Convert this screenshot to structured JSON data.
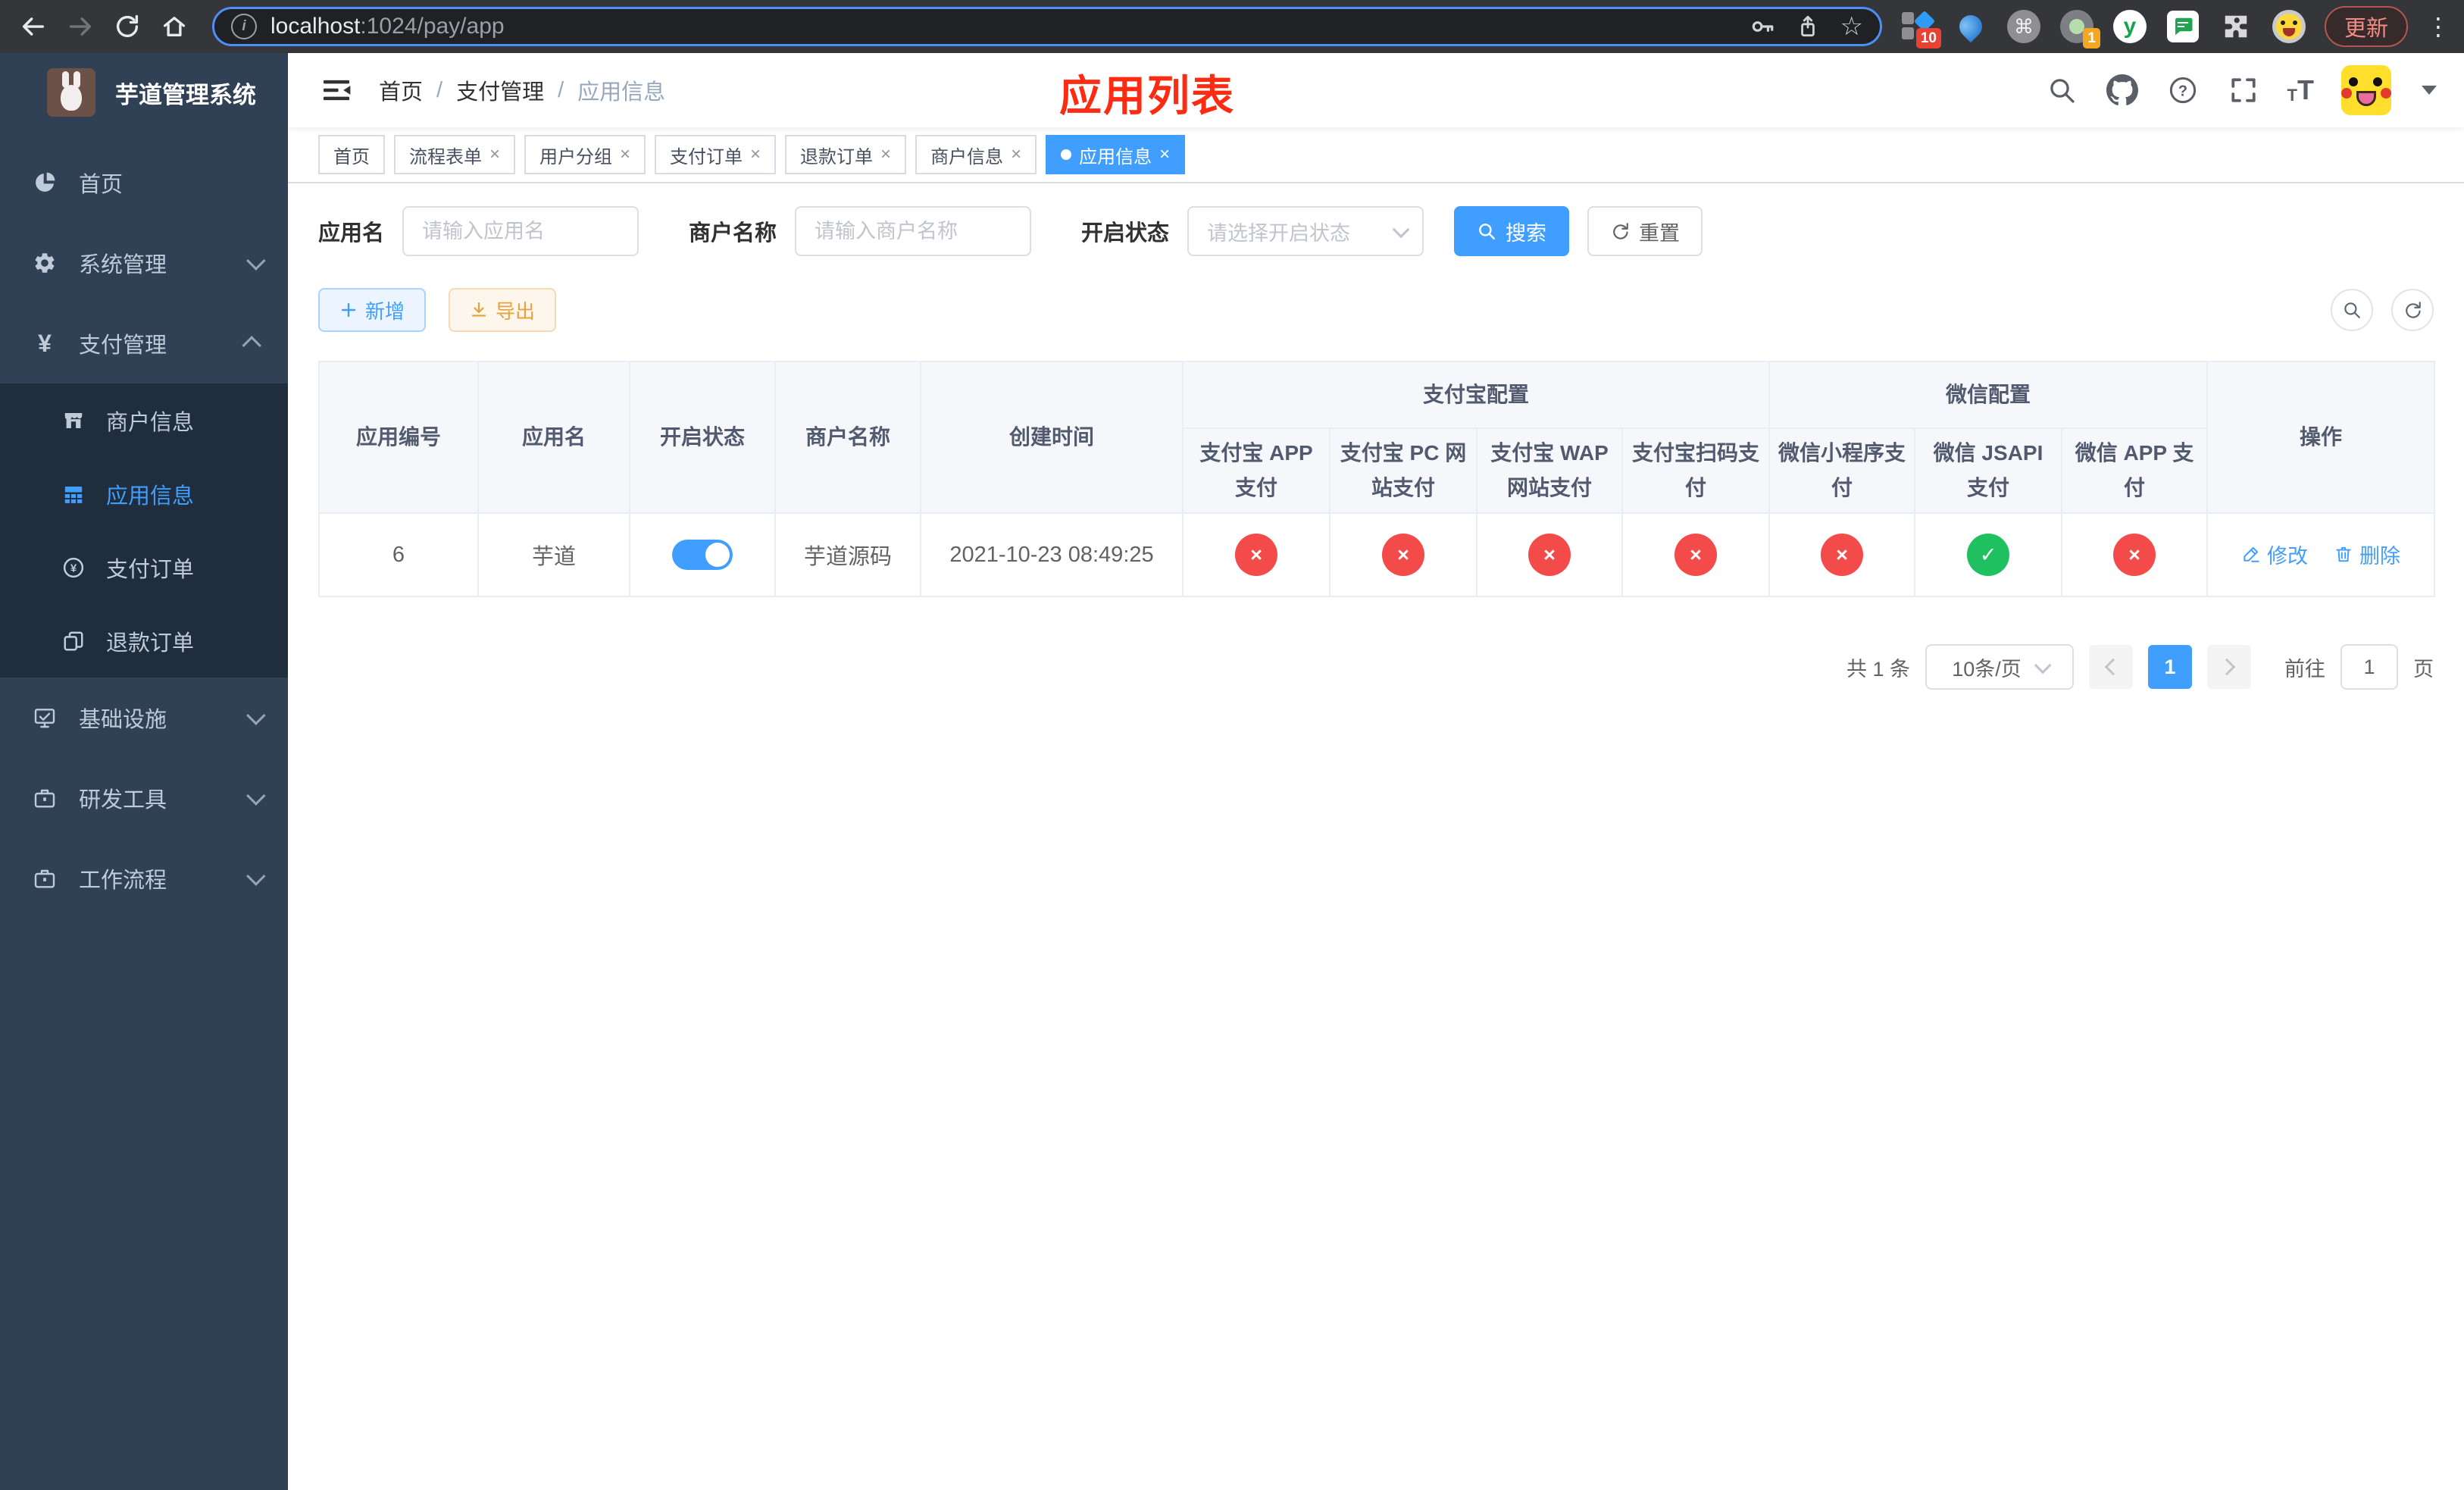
{
  "browser": {
    "url_host": "localhost",
    "url_path": ":1024/pay/app",
    "update_label": "更新"
  },
  "glyphs": {
    "close": "×",
    "cross": "×",
    "check": "✓",
    "cmd": "⌘",
    "more_dots": "⋮",
    "star": "☆",
    "info_i": "i",
    "question": "?",
    "badge_ten": "10",
    "badge_one": "1",
    "ext_y": "y",
    "yen": "¥",
    "font_small": "T",
    "font_large": "T"
  },
  "sidebar": {
    "title": "芋道管理系统",
    "menu": [
      {
        "label": "首页"
      },
      {
        "label": "系统管理"
      },
      {
        "label": "支付管理"
      },
      {
        "label": "基础设施"
      },
      {
        "label": "研发工具"
      },
      {
        "label": "工作流程"
      }
    ],
    "submenu": [
      {
        "label": "商户信息"
      },
      {
        "label": "应用信息"
      },
      {
        "label": "支付订单"
      },
      {
        "label": "退款订单"
      }
    ]
  },
  "header": {
    "breadcrumb": [
      "首页",
      "支付管理",
      "应用信息"
    ],
    "separator": "/",
    "annotation": "应用列表"
  },
  "tabs": [
    {
      "label": "首页",
      "closable": false,
      "active": false
    },
    {
      "label": "流程表单",
      "closable": true,
      "active": false
    },
    {
      "label": "用户分组",
      "closable": true,
      "active": false
    },
    {
      "label": "支付订单",
      "closable": true,
      "active": false
    },
    {
      "label": "退款订单",
      "closable": true,
      "active": false
    },
    {
      "label": "商户信息",
      "closable": true,
      "active": false
    },
    {
      "label": "应用信息",
      "closable": true,
      "active": true
    }
  ],
  "filters": {
    "app_name_label": "应用名",
    "app_name_placeholder": "请输入应用名",
    "merchant_label": "商户名称",
    "merchant_placeholder": "请输入商户名称",
    "status_label": "开启状态",
    "status_placeholder": "请选择开启状态",
    "search_label": "搜索",
    "reset_label": "重置"
  },
  "toolbar": {
    "add_label": "新增",
    "export_label": "导出"
  },
  "table": {
    "columns": {
      "app_id": "应用编号",
      "app_name": "应用名",
      "open_status": "开启状态",
      "merchant_name": "商户名称",
      "create_time": "创建时间",
      "alipay_group": "支付宝配置",
      "wechat_group": "微信配置",
      "alipay": [
        "支付宝 APP 支付",
        "支付宝 PC 网站支付",
        "支付宝 WAP 网站支付",
        "支付宝扫码支付"
      ],
      "wechat": [
        "微信小程序支付",
        "微信 JSAPI 支付",
        "微信 APP 支付"
      ],
      "ops": "操作"
    },
    "row": {
      "app_id": "6",
      "app_name": "芋道",
      "enabled": true,
      "merchant_name": "芋道源码",
      "create_time": "2021-10-23 08:49:25",
      "channels": [
        "disabled",
        "disabled",
        "disabled",
        "disabled",
        "disabled",
        "enabled",
        "disabled"
      ],
      "edit_label": "修改",
      "delete_label": "删除"
    }
  },
  "pagination": {
    "total": "共 1 条",
    "page_size": "10条/页",
    "current": "1",
    "goto_label": "前往",
    "goto_value": "1",
    "page_unit": "页"
  },
  "colors": {
    "accent": "#409eff",
    "danger": "#f34a4a",
    "success": "#1fc05f",
    "warning": "#e6a23c",
    "annotation": "#fd2b12",
    "sidebar_bg": "#304156",
    "submenu_bg": "#1f2d3d"
  }
}
